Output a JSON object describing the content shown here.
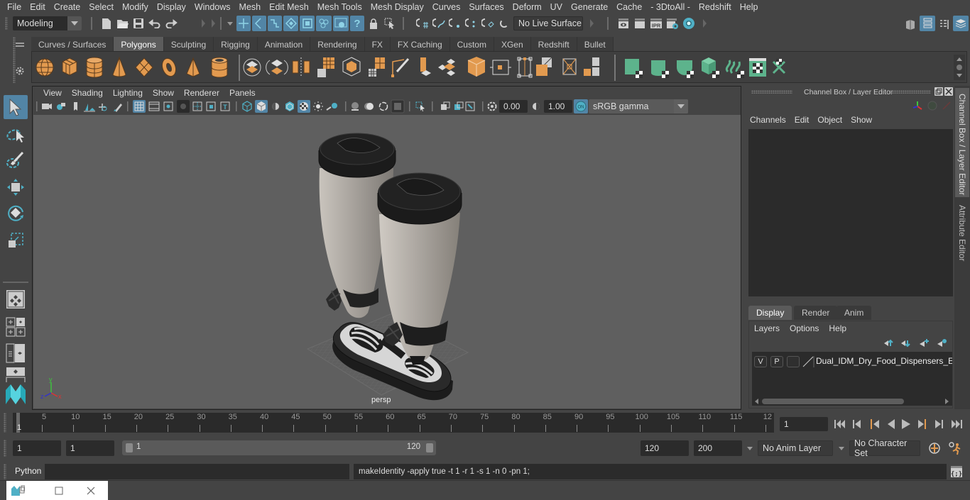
{
  "menubar": {
    "items": [
      "File",
      "Edit",
      "Create",
      "Select",
      "Modify",
      "Display",
      "Windows",
      "Mesh",
      "Edit Mesh",
      "Mesh Tools",
      "Mesh Display",
      "Curves",
      "Surfaces",
      "Deform",
      "UV",
      "Generate",
      "Cache",
      "- 3DtoAll -",
      "Redshift",
      "Help"
    ]
  },
  "statusline": {
    "mode": "Modeling",
    "live_surface": "No Live Surface",
    "icons": [
      "new-scene-icon",
      "open-scene-icon",
      "save-scene-icon",
      "undo-icon",
      "redo-icon",
      "select-by-hierarchy-icon",
      "select-by-object-type-icon",
      "select-by-component-icon",
      "snap-grid-icon",
      "snap-curve-icon",
      "snap-point-icon",
      "snap-view-plane-icon",
      "snap-live-icon",
      "render-view-icon",
      "render-frame-icon",
      "ipr-render-icon",
      "render-settings-icon",
      "hypershade-icon"
    ],
    "ipr_label": "IPR"
  },
  "shelf": {
    "tabs": [
      "Curves / Surfaces",
      "Polygons",
      "Sculpting",
      "Rigging",
      "Animation",
      "Rendering",
      "FX",
      "FX Caching",
      "Custom",
      "XGen",
      "Redshift",
      "Bullet"
    ],
    "active_tab": "Polygons",
    "accent_orange": "#e29a4f",
    "accent_green": "#5db38c"
  },
  "viewport": {
    "menus": [
      "View",
      "Shading",
      "Lighting",
      "Show",
      "Renderer",
      "Panels"
    ],
    "exposure": "0.00",
    "gamma": "1.00",
    "color_space": "sRGB gamma",
    "camera_label": "persp",
    "axis": {
      "x": "x",
      "y": "y",
      "z": "z"
    },
    "background": "#5f5f5f"
  },
  "channel_box": {
    "title": "Channel Box / Layer Editor",
    "menus": [
      "Channels",
      "Edit",
      "Object",
      "Show"
    ]
  },
  "side_tabs": [
    "Channel Box / Layer Editor",
    "Attribute Editor"
  ],
  "layer_editor": {
    "tabs": [
      "Display",
      "Render",
      "Anim"
    ],
    "active_tab": "Display",
    "menus": [
      "Layers",
      "Options",
      "Help"
    ],
    "layers": [
      {
        "visible": "V",
        "playback": "P",
        "name": "Dual_IDM_Dry_Food_Dispensers_Emp"
      }
    ]
  },
  "timeline": {
    "ticks": [
      "5",
      "10",
      "15",
      "20",
      "25",
      "30",
      "35",
      "40",
      "45",
      "50",
      "55",
      "60",
      "65",
      "70",
      "75",
      "80",
      "85",
      "90",
      "95",
      "100",
      "105",
      "110",
      "115",
      "12"
    ],
    "current_frame_marker": "1",
    "current_frame": "1"
  },
  "range_slider": {
    "start_frame": "1",
    "playback_start": "1",
    "range_start": "1",
    "range_end": "120",
    "playback_end": "120",
    "end_frame": "200",
    "anim_layer": "No Anim Layer",
    "character_set": "No Character Set"
  },
  "command_line": {
    "language": "Python",
    "input_value": "",
    "result": "makeIdentity -apply true -t 1 -r 1 -s 1 -n 0 -pn 1;"
  }
}
